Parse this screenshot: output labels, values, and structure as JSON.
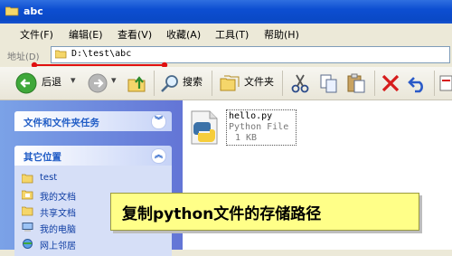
{
  "window": {
    "title": "abc"
  },
  "menu": {
    "items": [
      "文件(F)",
      "编辑(E)",
      "查看(V)",
      "收藏(A)",
      "工具(T)",
      "帮助(H)"
    ]
  },
  "address": {
    "label": "地址(D)",
    "value": "D:\\test\\abc"
  },
  "toolbar": {
    "back": "后退",
    "search": "搜索",
    "folders": "文件夹"
  },
  "sidebar": {
    "tasks_title": "文件和文件夹任务",
    "places_title": "其它位置",
    "places": [
      "test",
      "我的文档",
      "共享文档",
      "我的电脑",
      "网上邻居"
    ]
  },
  "file": {
    "name": "hello.py",
    "type": "Python File",
    "size": "1 KB"
  },
  "callout": {
    "text": "复制python文件的存储路径"
  },
  "colors": {
    "annotation_red": "#e01010",
    "callout_bg": "#ffff88",
    "xp_blue": "#0a49c6"
  }
}
